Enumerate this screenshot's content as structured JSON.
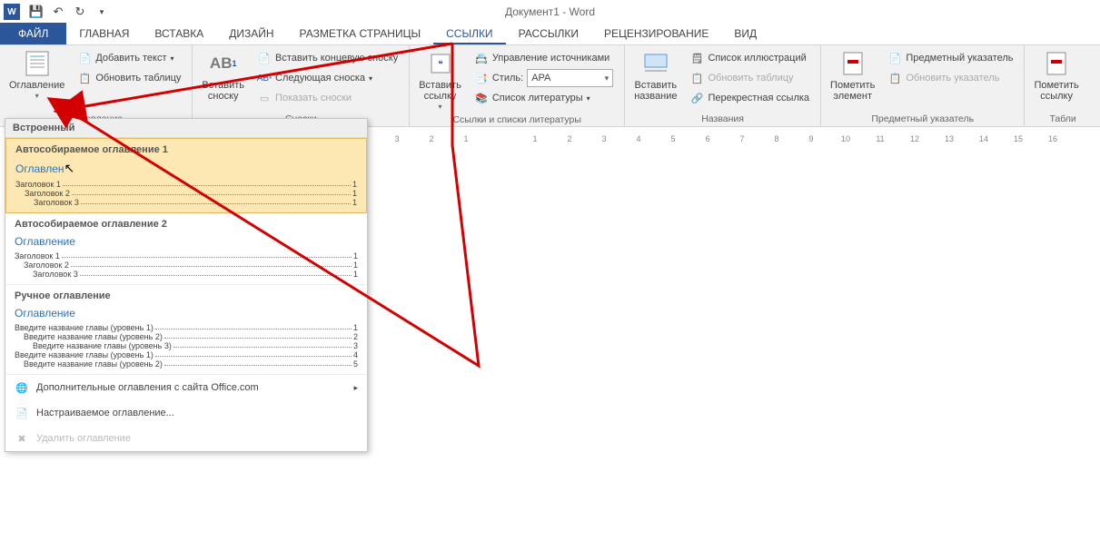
{
  "app_title": "Документ1 - Word",
  "qat": {
    "save": "Сохранить",
    "undo": "Отменить",
    "redo": "Повторить"
  },
  "tabs": {
    "file": "ФАЙЛ",
    "home": "ГЛАВНАЯ",
    "insert": "ВСТАВКА",
    "design": "ДИЗАЙН",
    "layout": "РАЗМЕТКА СТРАНИЦЫ",
    "references": "ССЫЛКИ",
    "mailings": "РАССЫЛКИ",
    "review": "РЕЦЕНЗИРОВАНИЕ",
    "view": "ВИД"
  },
  "ribbon": {
    "toc_group": {
      "label": "Оглавление",
      "btn": "Оглавление",
      "add_text": "Добавить текст",
      "update": "Обновить таблицу"
    },
    "footnotes_group": {
      "label": "Сноски",
      "btn": "Вставить\nсноску",
      "endnote": "Вставить концевую сноску",
      "next": "Следующая сноска",
      "show": "Показать сноски",
      "ab": "AB"
    },
    "citations_group": {
      "label": "Ссылки и списки литературы",
      "btn": "Вставить\nссылку",
      "manage": "Управление источниками",
      "style_label": "Стиль:",
      "style_value": "APA",
      "biblio": "Список литературы"
    },
    "captions_group": {
      "label": "Названия",
      "btn": "Вставить\nназвание",
      "fig_list": "Список иллюстраций",
      "update": "Обновить таблицу",
      "crossref": "Перекрестная ссылка"
    },
    "index_group": {
      "label": "Предметный указатель",
      "mark": "Пометить\nэлемент",
      "insert": "Предметный указатель",
      "update": "Обновить указатель"
    },
    "toa_group": {
      "label": "Табли",
      "mark": "Пометить\nссылку"
    }
  },
  "gallery": {
    "section_builtin": "Встроенный",
    "auto1": {
      "title": "Автособираемое оглавление 1",
      "heading": "Оглавлен",
      "rows": [
        [
          "Заголовок 1",
          "1"
        ],
        [
          "Заголовок 2",
          "1"
        ],
        [
          "Заголовок 3",
          "1"
        ]
      ]
    },
    "auto2": {
      "title": "Автособираемое оглавление 2",
      "heading": "Оглавление",
      "rows": [
        [
          "Заголовок 1",
          "1"
        ],
        [
          "Заголовок 2",
          "1"
        ],
        [
          "Заголовок 3",
          "1"
        ]
      ]
    },
    "manual": {
      "title": "Ручное оглавление",
      "heading": "Оглавление",
      "rows": [
        [
          "Введите название главы (уровень 1)",
          "1"
        ],
        [
          "Введите название главы (уровень 2)",
          "2"
        ],
        [
          "Введите название главы (уровень 3)",
          "3"
        ],
        [
          "Введите название главы (уровень 1)",
          "4"
        ],
        [
          "Введите название главы (уровень 2)",
          "5"
        ]
      ]
    },
    "footer_more": "Дополнительные оглавления с сайта Office.com",
    "footer_custom": "Настраиваемое оглавление...",
    "footer_remove": "Удалить оглавление"
  },
  "ruler_numbers": [
    "3",
    "2",
    "1",
    "",
    "1",
    "2",
    "3",
    "4",
    "5",
    "6",
    "7",
    "8",
    "9",
    "10",
    "11",
    "12",
    "13",
    "14",
    "15",
    "16"
  ]
}
